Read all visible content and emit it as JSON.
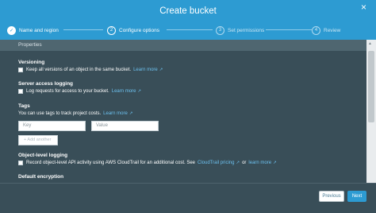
{
  "modal": {
    "title": "Create bucket",
    "close": "×"
  },
  "steps": [
    {
      "number": "✓",
      "label": "Name and region",
      "state": "done"
    },
    {
      "number": "2",
      "label": "Configure options",
      "state": "active"
    },
    {
      "number": "3",
      "label": "Set permissions",
      "state": "inactive"
    },
    {
      "number": "4",
      "label": "Review",
      "state": "inactive"
    }
  ],
  "section": {
    "title": "Properties"
  },
  "versioning": {
    "heading": "Versioning",
    "checkbox_label": "Keep all versions of an object in the same bucket.",
    "link": "Learn more"
  },
  "logging": {
    "heading": "Server access logging",
    "checkbox_label": "Log requests for access to your bucket.",
    "link": "Learn more"
  },
  "tags": {
    "heading": "Tags",
    "description": "You can use tags to track project costs.",
    "link": "Learn more",
    "key_placeholder": "Key",
    "value_placeholder": "Value",
    "add_button": "+ Add another"
  },
  "object_logging": {
    "heading": "Object-level logging",
    "checkbox_label": "Record object-level API activity using AWS CloudTrail for an additional cost. See",
    "pricing_link": "CloudTrail pricing",
    "or_text": "or",
    "link": "learn more"
  },
  "encryption": {
    "heading": "Default encryption"
  },
  "footer": {
    "previous": "Previous",
    "next": "Next"
  },
  "colors": {
    "header": "#2d9bd2",
    "body": "#394e58",
    "link": "#6cc0ee"
  },
  "icons": {
    "external": "external-link-icon",
    "close": "close-icon",
    "check": "check-icon"
  }
}
